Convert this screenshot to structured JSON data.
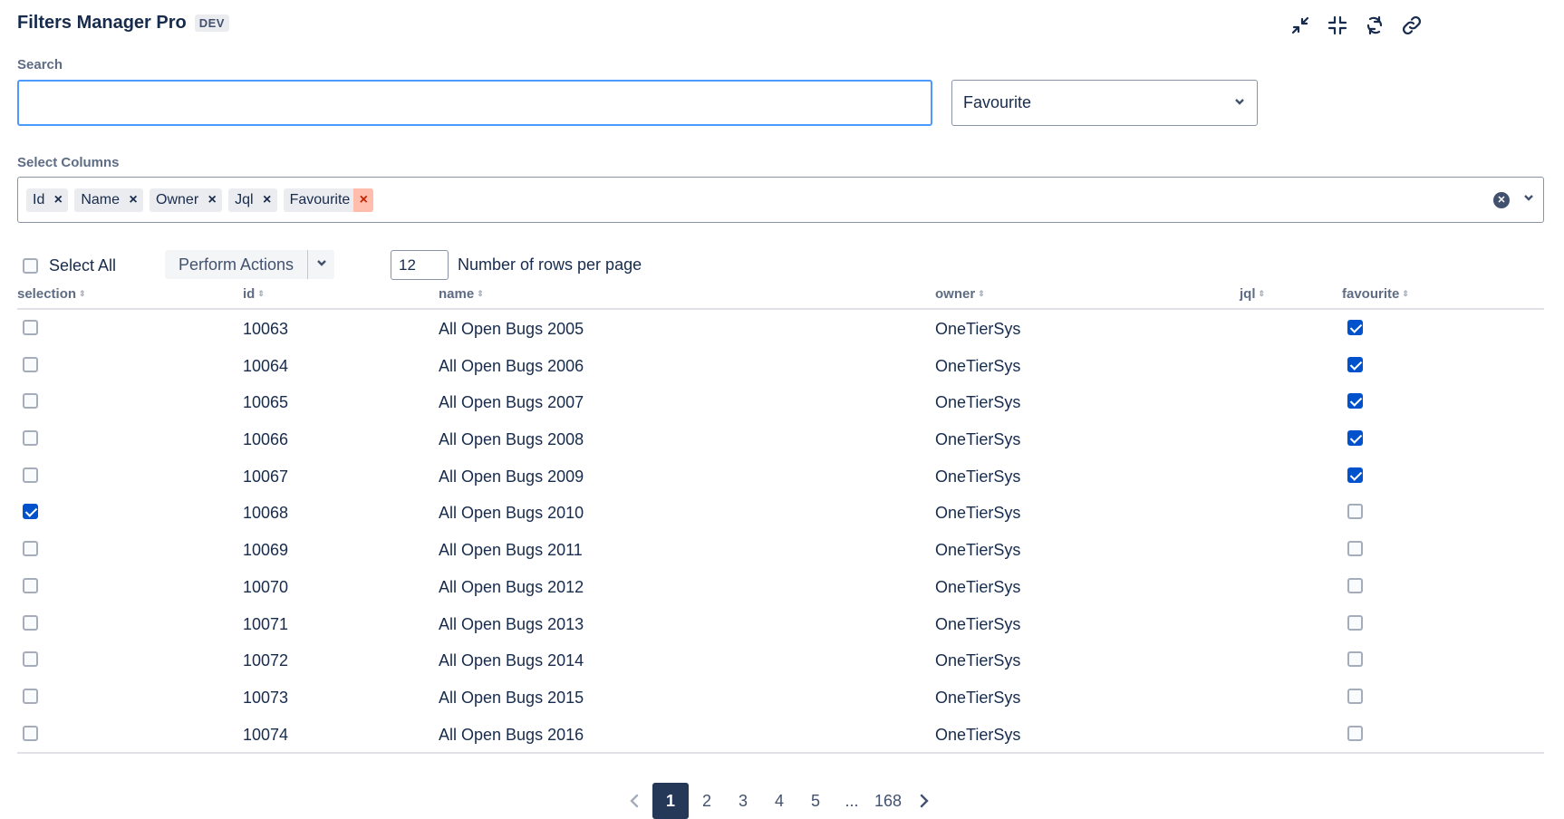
{
  "header": {
    "title": "Filters Manager Pro",
    "env": "DEV"
  },
  "search": {
    "label": "Search",
    "value": "",
    "placeholder": ""
  },
  "filter_select": {
    "value": "Favourite"
  },
  "columns_select": {
    "label": "Select Columns",
    "chips": [
      "Id",
      "Name",
      "Owner",
      "Jql",
      "Favourite"
    ]
  },
  "toolbar": {
    "select_all": "Select All",
    "perform_actions": "Perform Actions",
    "rows_per_page": "12",
    "rows_per_page_label": "Number of rows per page"
  },
  "table": {
    "headers": [
      "selection",
      "id",
      "name",
      "owner",
      "jql",
      "favourite"
    ],
    "rows": [
      {
        "id": "10063",
        "name": "All Open Bugs 2005",
        "owner": "OneTierSys",
        "jql": "",
        "selected": false,
        "favourite": true
      },
      {
        "id": "10064",
        "name": "All Open Bugs 2006",
        "owner": "OneTierSys",
        "jql": "",
        "selected": false,
        "favourite": true
      },
      {
        "id": "10065",
        "name": "All Open Bugs 2007",
        "owner": "OneTierSys",
        "jql": "",
        "selected": false,
        "favourite": true
      },
      {
        "id": "10066",
        "name": "All Open Bugs 2008",
        "owner": "OneTierSys",
        "jql": "",
        "selected": false,
        "favourite": true
      },
      {
        "id": "10067",
        "name": "All Open Bugs 2009",
        "owner": "OneTierSys",
        "jql": "",
        "selected": false,
        "favourite": true
      },
      {
        "id": "10068",
        "name": "All Open Bugs 2010",
        "owner": "OneTierSys",
        "jql": "",
        "selected": true,
        "favourite": false
      },
      {
        "id": "10069",
        "name": "All Open Bugs 2011",
        "owner": "OneTierSys",
        "jql": "",
        "selected": false,
        "favourite": false
      },
      {
        "id": "10070",
        "name": "All Open Bugs 2012",
        "owner": "OneTierSys",
        "jql": "",
        "selected": false,
        "favourite": false
      },
      {
        "id": "10071",
        "name": "All Open Bugs 2013",
        "owner": "OneTierSys",
        "jql": "",
        "selected": false,
        "favourite": false
      },
      {
        "id": "10072",
        "name": "All Open Bugs 2014",
        "owner": "OneTierSys",
        "jql": "",
        "selected": false,
        "favourite": false
      },
      {
        "id": "10073",
        "name": "All Open Bugs 2015",
        "owner": "OneTierSys",
        "jql": "",
        "selected": false,
        "favourite": false
      },
      {
        "id": "10074",
        "name": "All Open Bugs 2016",
        "owner": "OneTierSys",
        "jql": "",
        "selected": false,
        "favourite": false
      }
    ]
  },
  "pagination": {
    "pages": [
      "1",
      "2",
      "3",
      "4",
      "5",
      "...",
      "168"
    ],
    "current": "1"
  },
  "icons": {
    "top": [
      "minimize-icon",
      "collapse-icon",
      "refresh-icon",
      "link-icon"
    ]
  },
  "colors": {
    "accent": "#0052cc",
    "focus": "#4c9aff",
    "chip_remove_hover": "#ffbdad",
    "active_page": "#253858"
  }
}
